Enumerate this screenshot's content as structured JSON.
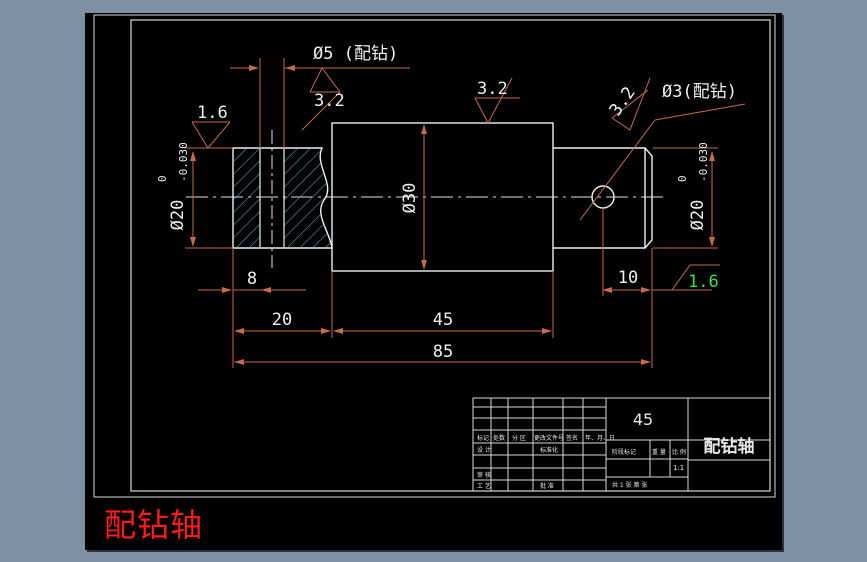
{
  "drawing": {
    "part_name": "配钻轴",
    "material": "45",
    "scale": "1:1",
    "dimensions": {
      "d5_hole": "Ø5 (配钻)",
      "d3_hole": "Ø3(配钻)",
      "d30": "Ø30",
      "d20_left": "Ø20",
      "d20_right": "Ø20",
      "tol_upper": "0",
      "tol_lower": "-0.030",
      "len_8": "8",
      "len_20": "20",
      "len_45": "45",
      "len_85": "85",
      "len_10": "10"
    },
    "roughness": {
      "left": "1.6",
      "hole_5": "3.2",
      "middle": "3.2",
      "right_top": "3.2",
      "right_bottom": "1.6"
    },
    "title_block": {
      "col_headers": [
        "标记",
        "处数",
        "分 区",
        "更改文件号",
        "签名",
        "年、月、日"
      ],
      "row_design": "设 计",
      "row_standard": "标准化",
      "row_review": "审 核",
      "row_process": "工 艺",
      "row_approve": "批 准",
      "stage_mark": "阶段标记",
      "weight": "重 量",
      "scale_label": "比 例",
      "sheet_info": "共 1 张  第 张"
    }
  },
  "caption": "配钻轴"
}
